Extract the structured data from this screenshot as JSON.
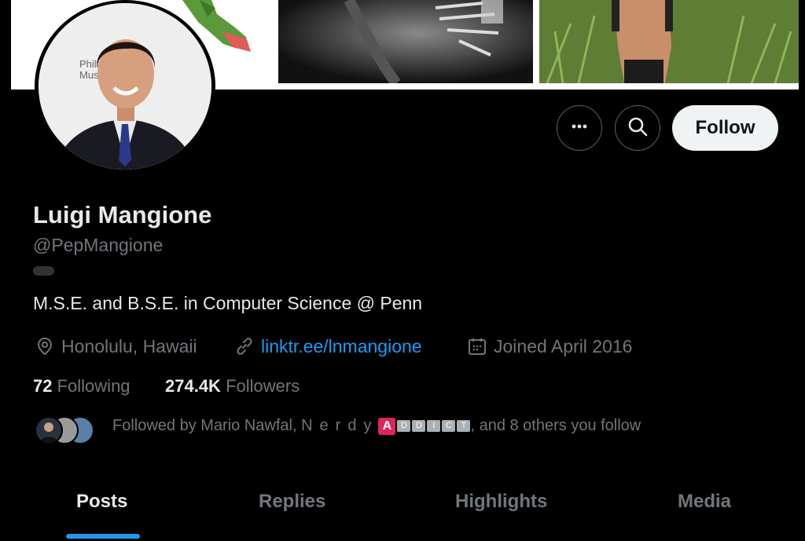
{
  "profile": {
    "name": "Luigi Mangione",
    "handle": "@PepMangione",
    "bio": "M.S.E. and B.S.E. in Computer Science @ Penn",
    "location": "Honolulu, Hawaii",
    "link": "linktr.ee/lnmangione",
    "joined": "Joined April 2016",
    "avatar_sign_text": "Philad\nMuse"
  },
  "actions": {
    "more_icon": "more-horizontal-icon",
    "search_icon": "search-icon",
    "follow_label": "Follow"
  },
  "counts": {
    "following_value": "72",
    "following_label": "Following",
    "followers_value": "274.4K",
    "followers_label": "Followers"
  },
  "followed_by": {
    "prefix": "Followed by Mario Nawfal, ",
    "nerdy": "Nerdy",
    "badge_letter": "A",
    "badge_small": [
      "D",
      "D",
      "I",
      "C",
      "T"
    ],
    "suffix": ", and 8 others you follow"
  },
  "tabs": [
    {
      "label": "Posts",
      "active": true
    },
    {
      "label": "Replies",
      "active": false
    },
    {
      "label": "Highlights",
      "active": false
    },
    {
      "label": "Media",
      "active": false
    }
  ],
  "colors": {
    "accent": "#1d9bf0",
    "background": "#000000",
    "muted": "#71767b"
  }
}
